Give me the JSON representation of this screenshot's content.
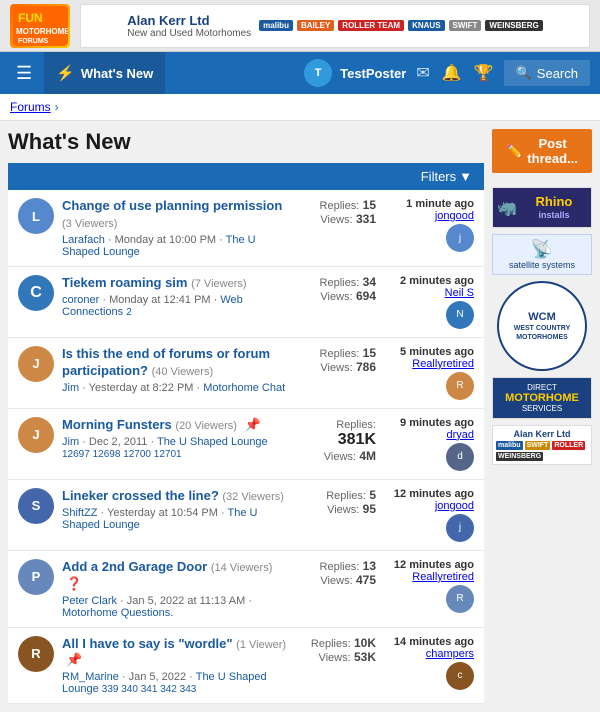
{
  "site": {
    "logo": "FUN",
    "ad_banner": {
      "company": "Alan Kerr Ltd",
      "tagline": "New and Used Motorhomes",
      "logos": [
        "malibu",
        "BAILEY",
        "ROLLER TEAM",
        "KNAUS",
        "SWIFT",
        "WEINSBERG"
      ]
    }
  },
  "navbar": {
    "whats_new_label": "What's New",
    "username": "TestPoster",
    "search_label": "Search"
  },
  "breadcrumb": {
    "forums_label": "Forums",
    "separator": "›"
  },
  "page": {
    "title": "What's New",
    "post_thread_label": "Post thread...",
    "filters_label": "Filters"
  },
  "threads": [
    {
      "id": 1,
      "title": "Change of use planning permission",
      "viewers": "3 Viewers",
      "author": "Larafach",
      "date": "Monday at 10:00 PM",
      "subforum": "The U Shaped Lounge",
      "replies": 15,
      "views": 331,
      "last_time": "1 minute ago",
      "last_user": "jongood",
      "avatar_color": "#5588cc",
      "avatar_letter": "L",
      "pinned": false,
      "help": false,
      "pages": []
    },
    {
      "id": 2,
      "title": "Tiekem roaming sim",
      "viewers": "7 Viewers",
      "author": "coroner",
      "date": "Monday at 12:41 PM",
      "subforum": "Web Connections",
      "replies": 34,
      "views": 694,
      "last_time": "2 minutes ago",
      "last_user": "Neil S",
      "avatar_color": "#3377bb",
      "avatar_letter": "C",
      "pinned": false,
      "help": false,
      "pages": [
        "2"
      ]
    },
    {
      "id": 3,
      "title": "Is this the end of forums or forum participation?",
      "viewers": "40 Viewers",
      "author": "Jim",
      "date": "Yesterday at 8:22 PM",
      "subforum": "Motorhome Chat",
      "replies": 15,
      "views": 786,
      "last_time": "5 minutes ago",
      "last_user": "Reallyretired",
      "avatar_color": "#cc8844",
      "avatar_letter": "J",
      "pinned": false,
      "help": false,
      "pages": []
    },
    {
      "id": 4,
      "title": "Morning Funsters",
      "viewers": "20 Viewers",
      "author": "Jim",
      "date": "Dec 2, 2011",
      "subforum": "The U Shaped Lounge",
      "replies_label": "381K",
      "views_label": "4M",
      "replies": 381000,
      "views": 4000000,
      "last_time": "9 minutes ago",
      "last_user": "dryad",
      "avatar_color": "#cc8844",
      "avatar_letter": "J",
      "pinned": true,
      "help": false,
      "pages": [
        "12697",
        "12698",
        "12700",
        "12701"
      ]
    },
    {
      "id": 5,
      "title": "Lineker crossed the line?",
      "viewers": "32 Viewers",
      "author": "ShiftZZ",
      "date": "Yesterday at 10:54 PM",
      "subforum": "The U Shaped Lounge",
      "replies": 5,
      "views": 95,
      "last_time": "12 minutes ago",
      "last_user": "jongood",
      "avatar_color": "#4466aa",
      "avatar_letter": "S",
      "pinned": false,
      "help": false,
      "pages": []
    },
    {
      "id": 6,
      "title": "Add a 2nd Garage Door",
      "viewers": "14 Viewers",
      "author": "Peter Clark",
      "date": "Jan 5, 2022 at 11:13 AM",
      "subforum": "Motorhome Questions.",
      "replies": 13,
      "views": 475,
      "last_time": "12 minutes ago",
      "last_user": "Reallyretired",
      "avatar_color": "#6688bb",
      "avatar_letter": "P",
      "pinned": false,
      "help": true,
      "pages": []
    },
    {
      "id": 7,
      "title": "All I have to say is \"wordle\"",
      "viewers": "1 Viewer",
      "author": "RM_Marine",
      "date": "Jan 5, 2022",
      "subforum": "The U Shaped Lounge",
      "replies_label": "10K",
      "views_label": "53K",
      "replies": 10000,
      "views": 53000,
      "last_time": "14 minutes ago",
      "last_user": "champers",
      "avatar_color": "#885522",
      "avatar_letter": "R",
      "pinned": true,
      "help": false,
      "pages": [
        "340",
        "341",
        "342",
        "343"
      ]
    }
  ],
  "sidebar": {
    "rhino_name": "Rhino",
    "rhino_installs": "installs",
    "satellite_text": "satellite systems",
    "wcm_line1": "WEST COUNTRY",
    "wcm_line2": "MOTORHOMES",
    "dms_line1": "DIRECT",
    "dms_name": "MOTORHOME",
    "dms_line2": "SERVICES"
  }
}
